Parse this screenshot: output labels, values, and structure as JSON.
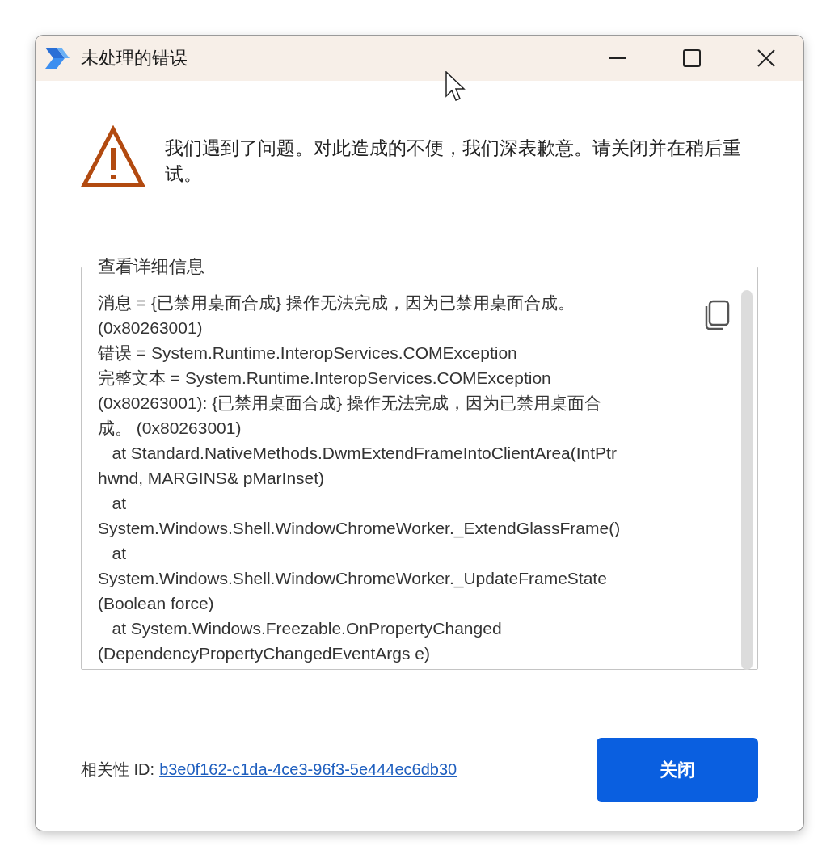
{
  "window": {
    "title": "未处理的错误"
  },
  "message": "我们遇到了问题。对此造成的不便，我们深表歉意。请关闭并在稍后重试。",
  "details": {
    "legend": "查看详细信息",
    "lines": [
      "消息 = {已禁用桌面合成} 操作无法完成，因为已禁用桌面合成。",
      "(0x80263001)",
      "错误 = System.Runtime.InteropServices.COMException",
      "完整文本 = System.Runtime.InteropServices.COMException",
      "(0x80263001): {已禁用桌面合成} 操作无法完成，因为已禁用桌面合",
      "成。 (0x80263001)",
      "   at Standard.NativeMethods.DwmExtendFrameIntoClientArea(IntPtr",
      "hwnd, MARGINS& pMarInset)",
      "   at",
      "System.Windows.Shell.WindowChromeWorker._ExtendGlassFrame()",
      "   at",
      "System.Windows.Shell.WindowChromeWorker._UpdateFrameState",
      "(Boolean force)",
      "   at System.Windows.Freezable.OnPropertyChanged",
      "(DependencyPropertyChangedEventArgs e)"
    ]
  },
  "correlation": {
    "label": "相关性 ID:",
    "id": "b3e0f162-c1da-4ce3-96f3-5e444ec6db30"
  },
  "buttons": [
    "关闭"
  ]
}
